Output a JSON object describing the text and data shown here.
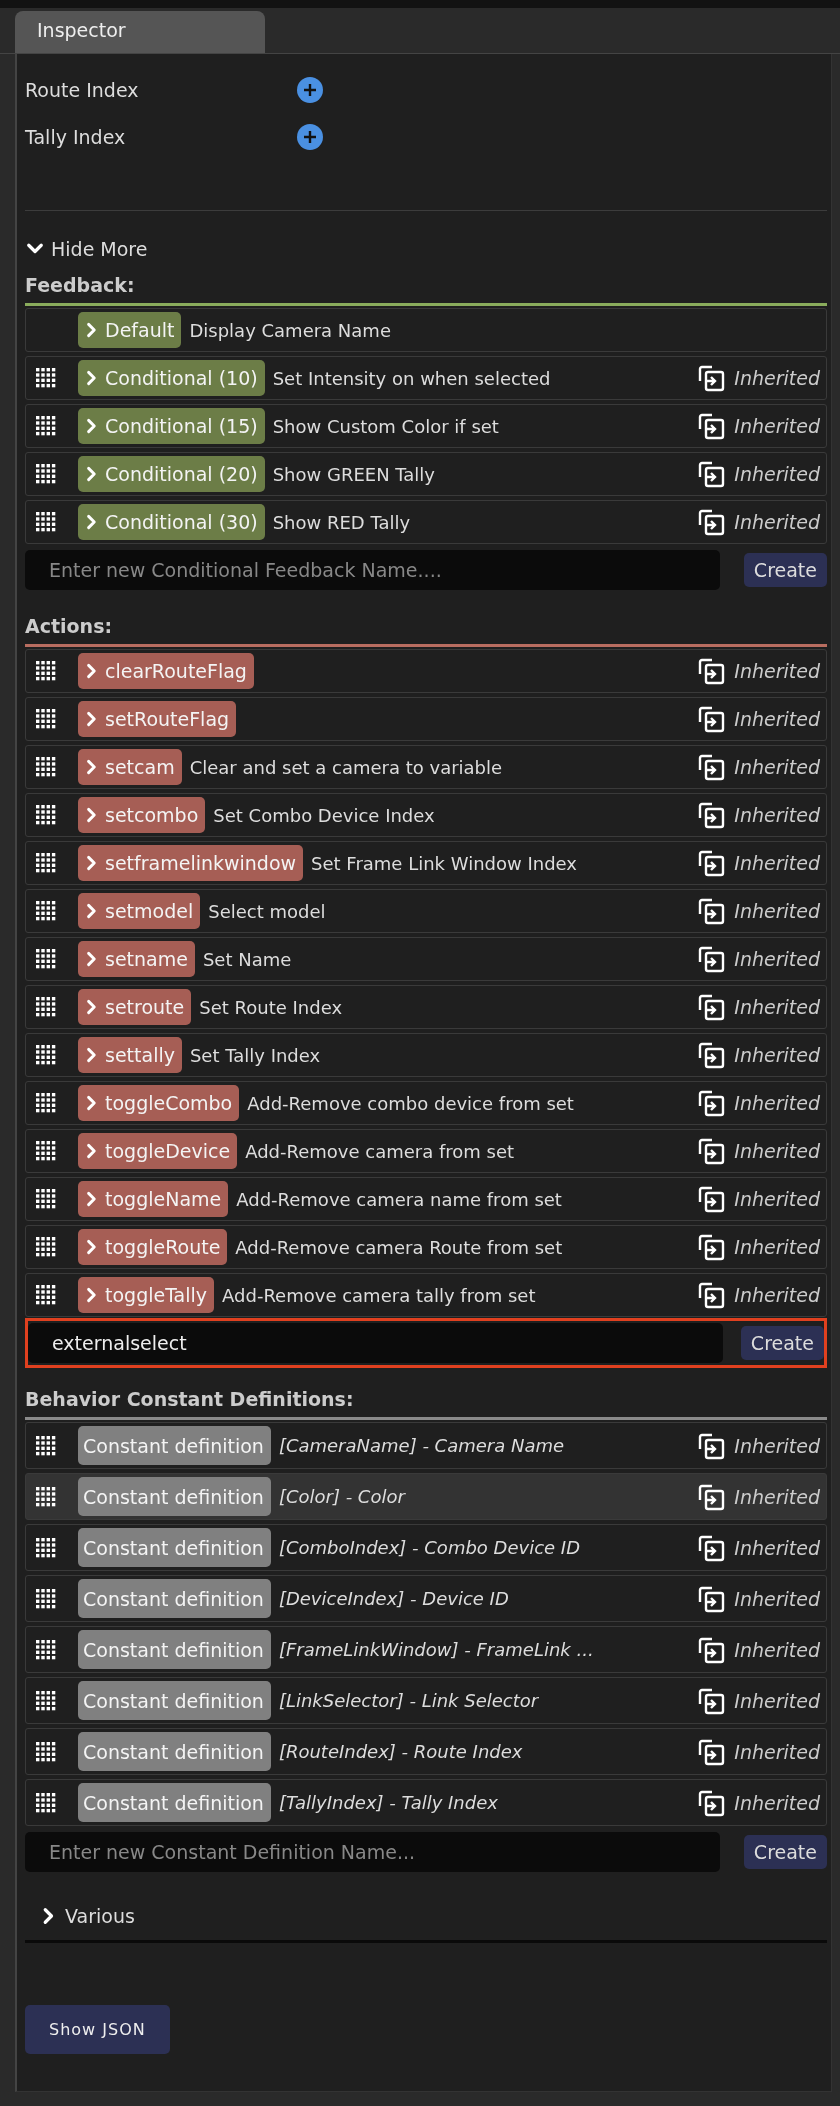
{
  "tab": {
    "label": "Inspector",
    "selected": true
  },
  "fields": [
    {
      "label": "Route Index"
    },
    {
      "label": "Tally Index"
    }
  ],
  "more_toggle": {
    "label": "Hide More",
    "expanded": true
  },
  "sections": [
    {
      "kind": "feedback",
      "title": "Feedback:",
      "items": [
        {
          "label": "Default",
          "description": "Display Camera Name",
          "draggable": false,
          "highlighted": false
        },
        {
          "label": "Conditional (10)",
          "description": "Set Intensity on when selected",
          "status": "Inherited",
          "draggable": true,
          "highlighted": false
        },
        {
          "label": "Conditional (15)",
          "description": "Show Custom Color if set",
          "status": "Inherited",
          "draggable": true,
          "highlighted": false
        },
        {
          "label": "Conditional (20)",
          "description": "Show GREEN Tally",
          "status": "Inherited",
          "draggable": true,
          "highlighted": false
        },
        {
          "label": "Conditional (30)",
          "description": "Show RED Tally",
          "status": "Inherited",
          "draggable": true,
          "highlighted": false
        }
      ],
      "input": {
        "placeholder": "Enter new Conditional Feedback Name....",
        "focused": false
      },
      "button": "Create"
    },
    {
      "kind": "action",
      "title": "Actions:",
      "items": [
        {
          "label": "clearRouteFlag",
          "status": "Inherited",
          "draggable": true,
          "highlighted": false
        },
        {
          "label": "setRouteFlag",
          "status": "Inherited",
          "draggable": true,
          "highlighted": false
        },
        {
          "label": "setcam",
          "description": "Clear and set a camera to variable",
          "status": "Inherited",
          "draggable": true,
          "highlighted": false
        },
        {
          "label": "setcombo",
          "description": "Set Combo Device Index",
          "status": "Inherited",
          "draggable": true,
          "highlighted": false
        },
        {
          "label": "setframelinkwindow",
          "description": "Set Frame Link Window Index",
          "status": "Inherited",
          "draggable": true,
          "highlighted": false
        },
        {
          "label": "setmodel",
          "description": "Select model",
          "status": "Inherited",
          "draggable": true,
          "highlighted": false
        },
        {
          "label": "setname",
          "description": "Set Name",
          "status": "Inherited",
          "draggable": true,
          "highlighted": false
        },
        {
          "label": "setroute",
          "description": "Set Route Index",
          "status": "Inherited",
          "draggable": true,
          "highlighted": false
        },
        {
          "label": "settally",
          "description": "Set Tally Index",
          "status": "Inherited",
          "draggable": true,
          "highlighted": false
        },
        {
          "label": "toggleCombo",
          "description": "Add-Remove combo device from set",
          "status": "Inherited",
          "draggable": true,
          "highlighted": false
        },
        {
          "label": "toggleDevice",
          "description": "Add-Remove camera from set",
          "status": "Inherited",
          "draggable": true,
          "highlighted": false
        },
        {
          "label": "toggleName",
          "description": "Add-Remove camera name from set",
          "status": "Inherited",
          "draggable": true,
          "highlighted": false
        },
        {
          "label": "toggleRoute",
          "description": "Add-Remove camera Route from set",
          "status": "Inherited",
          "draggable": true,
          "highlighted": false
        },
        {
          "label": "toggleTally",
          "description": "Add-Remove camera tally from set",
          "status": "Inherited",
          "draggable": true,
          "highlighted": false
        }
      ],
      "input": {
        "value": "externalselect",
        "focused": true
      },
      "button": "Create"
    },
    {
      "kind": "constant",
      "title": "Behavior Constant Definitions:",
      "items": [
        {
          "label": "Constant definition",
          "description": "[CameraName] - Camera Name",
          "status": "Inherited",
          "draggable": true,
          "highlighted": false
        },
        {
          "label": "Constant definition",
          "description": "[Color] - Color",
          "status": "Inherited",
          "draggable": true,
          "highlighted": true
        },
        {
          "label": "Constant definition",
          "description": "[ComboIndex] - Combo Device ID",
          "status": "Inherited",
          "draggable": true,
          "highlighted": false
        },
        {
          "label": "Constant definition",
          "description": "[DeviceIndex] - Device ID",
          "status": "Inherited",
          "draggable": true,
          "highlighted": false
        },
        {
          "label": "Constant definition",
          "description": "[FrameLinkWindow] - FrameLink ...",
          "status": "Inherited",
          "draggable": true,
          "highlighted": false
        },
        {
          "label": "Constant definition",
          "description": "[LinkSelector] - Link Selector",
          "status": "Inherited",
          "draggable": true,
          "highlighted": false
        },
        {
          "label": "Constant definition",
          "description": "[RouteIndex] - Route Index",
          "status": "Inherited",
          "draggable": true,
          "highlighted": false
        },
        {
          "label": "Constant definition",
          "description": "[TallyIndex] - Tally Index",
          "status": "Inherited",
          "draggable": true,
          "highlighted": false
        }
      ],
      "input": {
        "placeholder": "Enter new Constant Definition Name...",
        "focused": false
      },
      "button": "Create"
    }
  ],
  "various": {
    "label": "Various",
    "expanded": false
  },
  "show_json_button": "Show JSON"
}
